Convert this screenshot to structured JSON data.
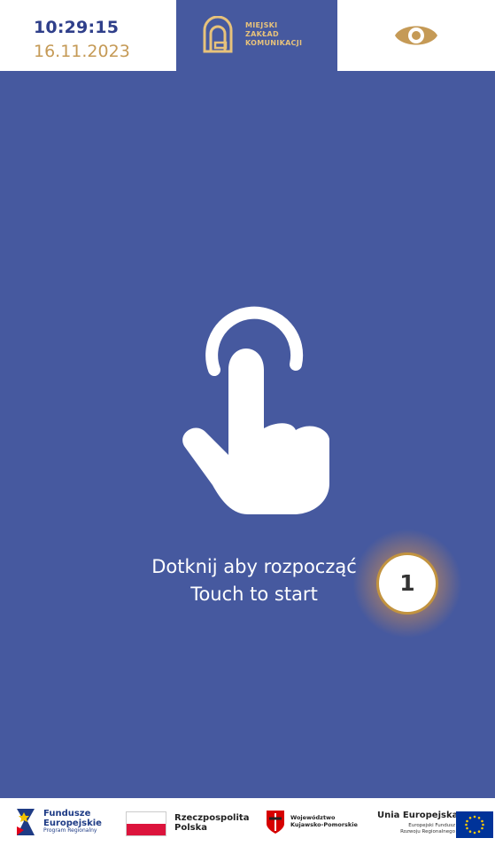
{
  "header": {
    "time": "10:29:15",
    "date": "16.11.2023",
    "logo_text_line1": "MIEJSKI",
    "logo_text_line2": "ZAKŁAD",
    "logo_text_line3": "KOMUNIKACJI",
    "accessibility_icon": "eye-icon"
  },
  "main": {
    "icon": "touch-hand-icon",
    "prompt_pl": "Dotknij aby rozpocząć",
    "prompt_en": "Touch to start",
    "marker_label": "1"
  },
  "footer": {
    "logo1_line1": "Fundusze",
    "logo1_line2": "Europejskie",
    "logo1_line3": "Program Regionalny",
    "logo2_line1": "Rzeczpospolita",
    "logo2_line2": "Polska",
    "logo3_line1": "Województwo",
    "logo3_line2": "Kujawsko-Pomorskie",
    "logo4_line1": "Unia Europejska",
    "logo4_line2": "Europejski Fundusz",
    "logo4_line3": "Rozwoju Regionalnego"
  },
  "colors": {
    "background_blue": "#46599f",
    "accent_gold": "#c59a56",
    "time_blue": "#2f3f8a"
  }
}
